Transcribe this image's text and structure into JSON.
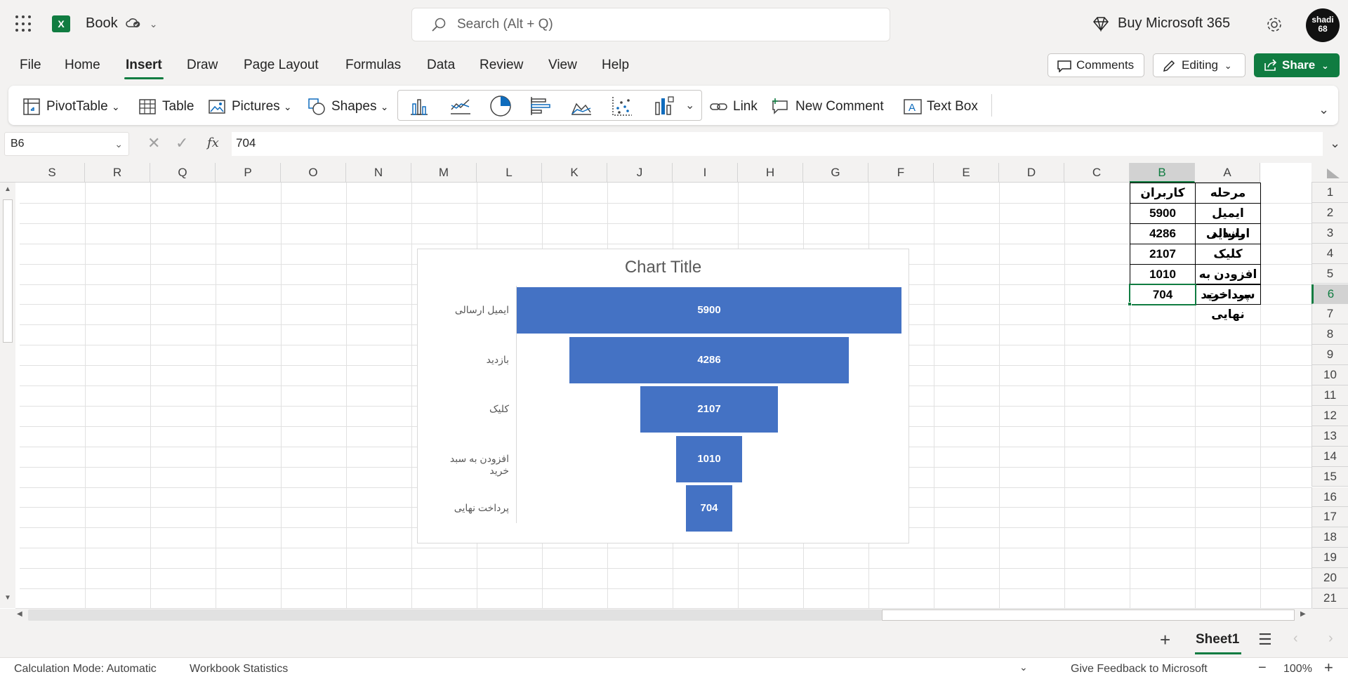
{
  "app": {
    "title": "Book",
    "search_placeholder": "Search (Alt + Q)",
    "buy_label": "Buy Microsoft 365",
    "avatar_text": "shadi 68"
  },
  "menu": {
    "items": [
      "File",
      "Home",
      "Insert",
      "Draw",
      "Page Layout",
      "Formulas",
      "Data",
      "Review",
      "View",
      "Help"
    ],
    "active": "Insert"
  },
  "actions": {
    "comments": "Comments",
    "editing": "Editing",
    "share": "Share"
  },
  "ribbon": {
    "pivot": "PivotTable",
    "table": "Table",
    "pictures": "Pictures",
    "shapes": "Shapes",
    "link": "Link",
    "new_comment": "New Comment",
    "text_box": "Text Box"
  },
  "formula_bar": {
    "name_box": "B6",
    "fx": "fx",
    "value": "704"
  },
  "columns": [
    "S",
    "R",
    "Q",
    "P",
    "O",
    "N",
    "M",
    "L",
    "K",
    "J",
    "I",
    "H",
    "G",
    "F",
    "E",
    "D",
    "C",
    "B",
    "A"
  ],
  "selected_column": "B",
  "rows": [
    "1",
    "2",
    "3",
    "4",
    "5",
    "6",
    "7",
    "8",
    "9",
    "10",
    "11",
    "12",
    "13",
    "14",
    "15",
    "16",
    "17",
    "18",
    "19",
    "20",
    "21"
  ],
  "selected_row": "6",
  "cells": {
    "A1": "مرحله",
    "B1": "کاربران",
    "A2": "ایمیل ارسالی",
    "B2": "5900",
    "A3": "بازدید",
    "B3": "4286",
    "A4": "کلیک",
    "B4": "2107",
    "A5": "افزودن به سبد خرید",
    "B5": "1010",
    "A6": "پرداخت نهایی",
    "B6": "704"
  },
  "chart_data": {
    "type": "bar",
    "subtype": "funnel",
    "title": "Chart Title",
    "categories": [
      "ایمیل ارسالی",
      "بازدید",
      "کلیک",
      "افزودن به سبد خرید",
      "پرداخت نهایی"
    ],
    "values": [
      5900,
      4286,
      2107,
      1010,
      704
    ],
    "data_labels": true,
    "color": "#4472c4"
  },
  "sheet_tabs": {
    "add": "+",
    "active": "Sheet1"
  },
  "status": {
    "calc_mode": "Calculation Mode: Automatic",
    "stats": "Workbook Statistics",
    "feedback": "Give Feedback to Microsoft",
    "zoom": "100%"
  },
  "colors": {
    "accent": "#107c41",
    "bar": "#4472c4"
  }
}
